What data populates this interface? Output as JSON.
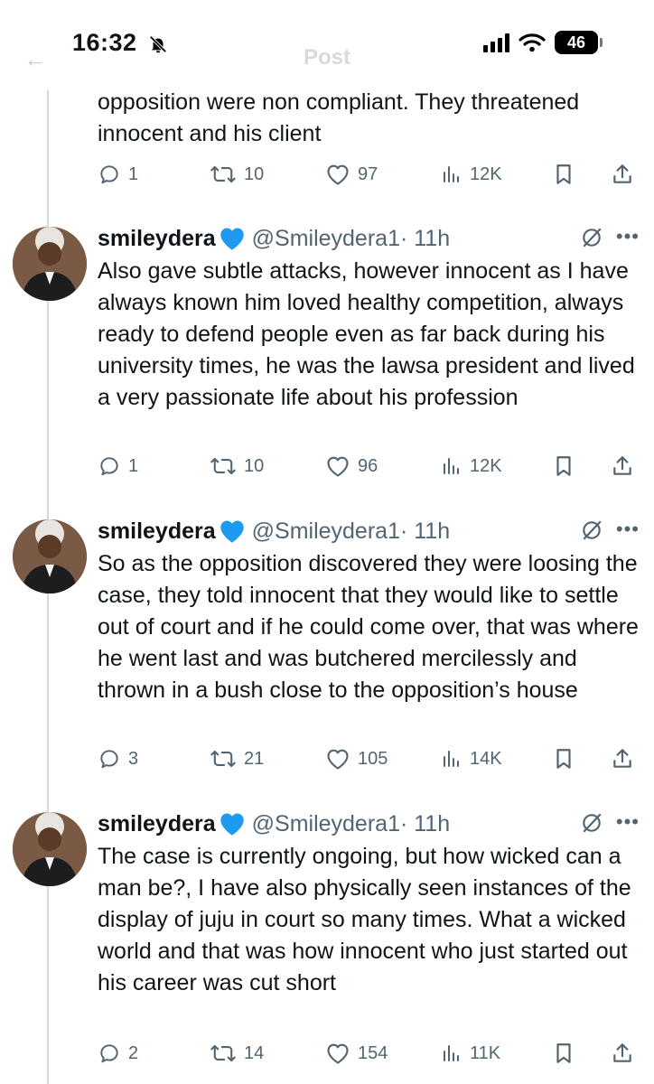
{
  "status_bar": {
    "time": "16:32",
    "battery": "46"
  },
  "header": {
    "back_glyph": "←",
    "title": "Post"
  },
  "continuation": {
    "text": "opposition were non compliant. They threatened innocent and his client",
    "actions": {
      "replies": "1",
      "reposts": "10",
      "likes": "97",
      "views": "12K"
    }
  },
  "tweets": [
    {
      "name": "smileydera",
      "handle": "@Smileydera1",
      "time": "· 11h",
      "text": "Also gave subtle attacks, however innocent as I have always known him loved healthy competition, always ready to defend people even as far back during his university times, he was the lawsa president and lived a very passionate life about his profession",
      "actions": {
        "replies": "1",
        "reposts": "10",
        "likes": "96",
        "views": "12K"
      }
    },
    {
      "name": "smileydera",
      "handle": "@Smileydera1",
      "time": "· 11h",
      "text": "So as the opposition discovered they were loosing the case, they told innocent that they would like to settle out of court and if he could come over, that was where he went last and was butchered mercilessly and thrown in a bush close to the opposition’s house",
      "actions": {
        "replies": "3",
        "reposts": "21",
        "likes": "105",
        "views": "14K"
      }
    },
    {
      "name": "smileydera",
      "handle": "@Smileydera1",
      "time": "· 11h",
      "text": "The case is currently ongoing, but how wicked can a man be?, I have also physically seen instances of the display of juju in court so many times. What a wicked world and that was how innocent who just started out his career was cut short",
      "actions": {
        "replies": "2",
        "reposts": "14",
        "likes": "154",
        "views": "11K"
      }
    }
  ],
  "colors": {
    "text": "#0f1419",
    "secondary": "#536471",
    "verified": "#1d9bf0",
    "line": "#cfd9de"
  },
  "icons": [
    "bell-slash-icon",
    "signal-icon",
    "wifi-icon",
    "battery-icon",
    "reply-icon",
    "repost-icon",
    "like-icon",
    "views-icon",
    "bookmark-icon",
    "share-icon",
    "verified-heart-icon",
    "grok-icon",
    "more-icon"
  ]
}
